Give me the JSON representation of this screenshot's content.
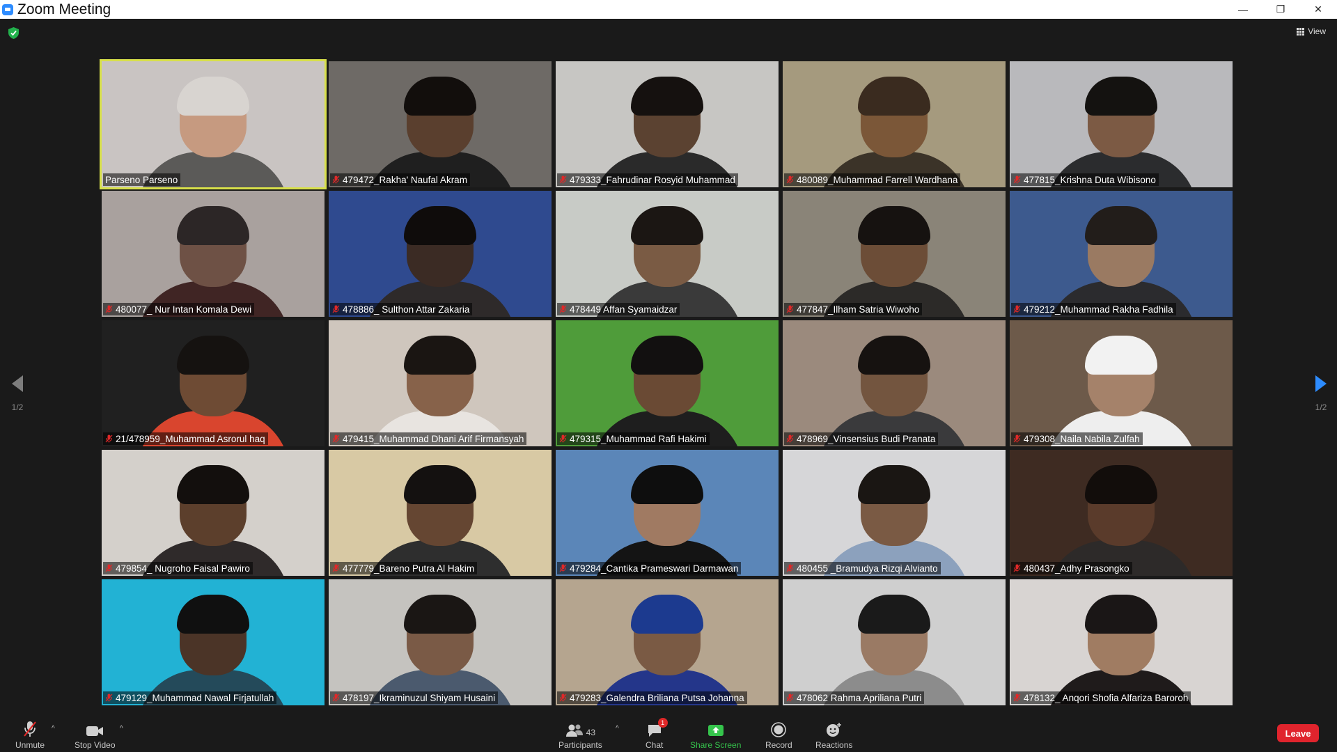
{
  "window": {
    "title": "Zoom Meeting",
    "controls": {
      "minimize": "—",
      "restore": "❐",
      "close": "✕"
    }
  },
  "header": {
    "view_label": "View",
    "security_icon": "shield-check-icon"
  },
  "pager": {
    "left_label": "1/2",
    "right_label": "1/2"
  },
  "participants": [
    {
      "name": "Parseno Parseno",
      "muted": false,
      "active": true,
      "bg": "#c9c4c2",
      "body": "#5b5a58",
      "skin": "#c69a80",
      "hair": "#d8d4d0"
    },
    {
      "name": "479472_Rakha' Naufal Akram",
      "muted": true,
      "bg": "#6e6a66",
      "body": "#1f1f1f",
      "skin": "#5a3f2e",
      "hair": "#120e0c"
    },
    {
      "name": "479333_Fahrudinar Rosyid Muhammad",
      "muted": true,
      "bg": "#c7c6c3",
      "body": "#2a2a2a",
      "skin": "#5b4231",
      "hair": "#15110f"
    },
    {
      "name": "480089_Muhammad Farrell Wardhana",
      "muted": true,
      "bg": "#a59a7e",
      "body": "#3b3328",
      "skin": "#7b5738",
      "hair": "#3a2b1f"
    },
    {
      "name": "477815_Krishna Duta Wibisono",
      "muted": true,
      "bg": "#b9b9bc",
      "body": "#2b2c2e",
      "skin": "#7c5a44",
      "hair": "#141210"
    },
    {
      "name": "480077_ Nur Intan Komala Dewi",
      "muted": true,
      "bg": "#a9a19e",
      "body": "#402524",
      "skin": "#6e5145",
      "hair": "#2c2626"
    },
    {
      "name": "478886_ Sulthon Attar Zakaria",
      "muted": true,
      "bg": "#2f4a8f",
      "body": "#2e2a2a",
      "skin": "#3b2b24",
      "hair": "#0f0c0b"
    },
    {
      "name": "478449 Affan Syamaidzar",
      "muted": true,
      "bg": "#c8cbc6",
      "body": "#3a3a3a",
      "skin": "#7a5b44",
      "hair": "#1b1613"
    },
    {
      "name": "477847_Ilham Satria Wiwoho",
      "muted": true,
      "bg": "#8a8478",
      "body": "#2c2a28",
      "skin": "#6c4d37",
      "hair": "#161210"
    },
    {
      "name": "479212_Muhammad Rakha Fadhila",
      "muted": true,
      "bg": "#3d5a8e",
      "body": "#2b2b2e",
      "skin": "#9a7a62",
      "hair": "#221d1a"
    },
    {
      "name": "21/478959_Muhammad Asrorul haq",
      "muted": true,
      "bg": "#202020",
      "body": "#d9452e",
      "skin": "#6e4b34",
      "hair": "#151210"
    },
    {
      "name": "479415_Muhammad Dhani Arif Firmansyah",
      "muted": true,
      "bg": "#cfc6bd",
      "body": "#e8e4e0",
      "skin": "#87624a",
      "hair": "#1a1512"
    },
    {
      "name": "479315_Muhammad Rafi Hakimi",
      "muted": true,
      "bg": "#4f9c3a",
      "body": "#1e1e1e",
      "skin": "#6a4a34",
      "hair": "#121010"
    },
    {
      "name": "478969_Vinsensius Budi Pranata",
      "muted": true,
      "bg": "#9b8a7d",
      "body": "#3a3a3c",
      "skin": "#73553f",
      "hair": "#161210"
    },
    {
      "name": "479308_Naila Nabila Zulfah",
      "muted": true,
      "bg": "#6d5a4a",
      "body": "#eeeeee",
      "skin": "#a5826a",
      "hair": "#f2f2f2"
    },
    {
      "name": "479854_ Nugroho Faisal Pawiro",
      "muted": true,
      "bg": "#d4d0cb",
      "body": "#2f2a2a",
      "skin": "#5c3f2c",
      "hair": "#130f0d"
    },
    {
      "name": "477779_Bareno Putra Al Hakim",
      "muted": true,
      "bg": "#d8c9a4",
      "body": "#2e2e2e",
      "skin": "#654632",
      "hair": "#141110"
    },
    {
      "name": "479284_Cantika Prameswari Darmawan",
      "muted": true,
      "bg": "#5b86b8",
      "body": "#141414",
      "skin": "#a07a62",
      "hair": "#0e0e0e"
    },
    {
      "name": "480455 _Bramudya Rizqi Alvianto",
      "muted": true,
      "bg": "#d6d6d8",
      "body": "#8ca1bd",
      "skin": "#7a5a44",
      "hair": "#1a1613"
    },
    {
      "name": "480437_Adhy Prasongko",
      "muted": true,
      "bg": "#3e2b22",
      "body": "#2d2a29",
      "skin": "#5a3b2b",
      "hair": "#120d0b"
    },
    {
      "name": "479129_Muhammad Nawal Firjatullah",
      "muted": true,
      "bg": "#22b2d4",
      "body": "#244a5a",
      "skin": "#4b3427",
      "hair": "#101010"
    },
    {
      "name": "478197_Ikraminuzul Shiyam Husaini",
      "muted": true,
      "bg": "#c5c3bf",
      "body": "#4b5a6e",
      "skin": "#7a5a46",
      "hair": "#1a1614"
    },
    {
      "name": "479283_Galendra Briliana Putsa Johanna",
      "muted": true,
      "bg": "#b5a58f",
      "body": "#24368a",
      "skin": "#7a5a44",
      "hair": "#1c3a8f"
    },
    {
      "name": "478062 Rahma Apriliana Putri",
      "muted": true,
      "bg": "#cfcfcf",
      "body": "#8c8c8c",
      "skin": "#9a7a64",
      "hair": "#1a1a1a"
    },
    {
      "name": "478132_ Anqori Shofia Alfariza Baroroh",
      "muted": true,
      "bg": "#d8d4d2",
      "body": "#1f1b1b",
      "skin": "#a07c62",
      "hair": "#1a1616"
    }
  ],
  "toolbar": {
    "unmute": "Unmute",
    "stop_video": "Stop Video",
    "participants": "Participants",
    "participants_count": "43",
    "chat": "Chat",
    "chat_badge": "1",
    "share_screen": "Share Screen",
    "record": "Record",
    "reactions": "Reactions",
    "leave": "Leave",
    "caret": "^"
  }
}
